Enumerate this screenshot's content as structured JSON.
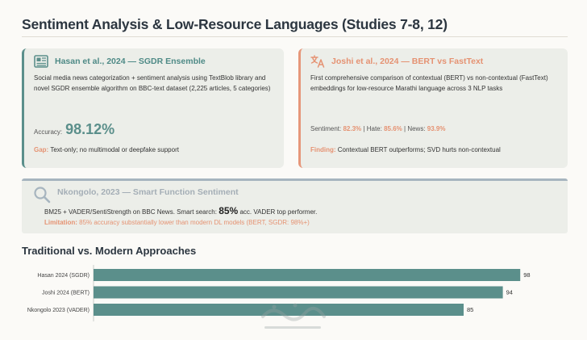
{
  "page": {
    "title": "Sentiment Analysis & Low-Resource Languages (Studies 7-8, 12)"
  },
  "cards": {
    "hasan": {
      "icon": "newspaper-icon",
      "title": "Hasan et al., 2024 — SGDR Ensemble",
      "description": "Social media news categorization + sentiment analysis using TextBlob library and novel SGDR ensemble algorithm on BBC-text dataset (2,225 articles, 5 categories)",
      "accuracy_label": "Accuracy:",
      "accuracy_value": "98.12%",
      "gap_label": "Gap:",
      "gap_text": "Text-only; no multimodal or deepfake support"
    },
    "joshi": {
      "icon": "translate-icon",
      "title": "Joshi et al., 2024 — BERT vs FastText",
      "description": "First comprehensive comparison of contextual (BERT) vs non-contextual (FastText) embeddings for low-resource Marathi language across 3 NLP tasks",
      "sentiment_label": "Sentiment:",
      "sentiment_value": "82.3%",
      "hate_label": "Hate:",
      "hate_value": "85.6%",
      "news_label": "News:",
      "news_value": "93.9%",
      "finding_label": "Finding:",
      "finding_text": "Contextual BERT outperforms; SVD hurts non-contextual"
    },
    "nkongolo": {
      "icon": "search-icon",
      "title": "Nkongolo, 2023 — Smart Function Sentiment",
      "desc_before": "BM25 + VADER/SentiStrength on BBC News. Smart search:",
      "desc_big": "85%",
      "desc_after": "acc. VADER top performer.",
      "limitation_label": "Limitation:",
      "limitation_text": "85% accuracy substantially lower than modern DL models (BERT, SGDR: 98%+)"
    }
  },
  "section": {
    "title": "Traditional vs. Modern Approaches"
  },
  "chart_data": {
    "type": "bar",
    "orientation": "horizontal",
    "categories": [
      "Hasan 2024 (SGDR)",
      "Joshi 2024 (BERT)",
      "Nkongolo 2023 (VADER)"
    ],
    "values": [
      98,
      94,
      85
    ],
    "xlim": [
      0,
      100
    ],
    "bar_color": "#5b8f8b",
    "grid": false,
    "legend": "none"
  },
  "colors": {
    "teal": "#5b8f8b",
    "orange": "#e59272",
    "gray": "#a7b5bf",
    "card_bg": "#eceee9"
  }
}
